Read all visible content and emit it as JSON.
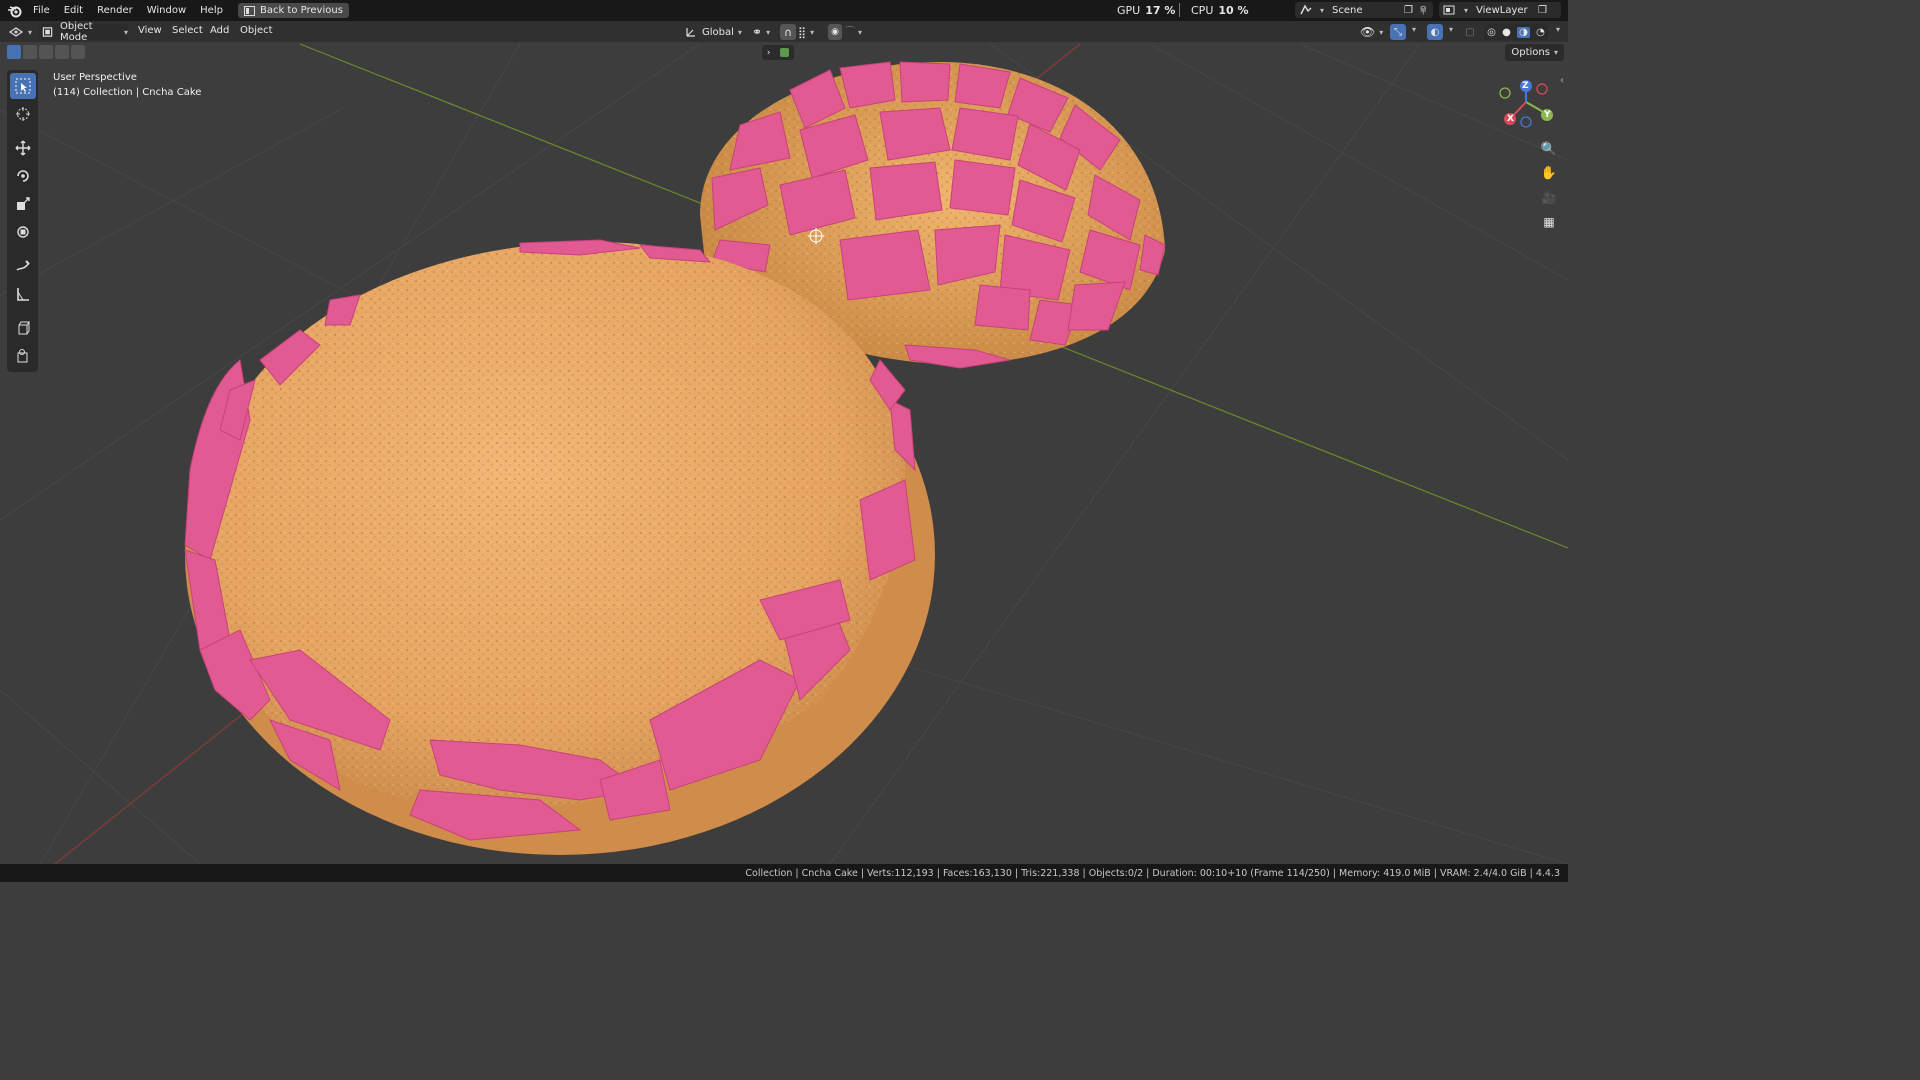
{
  "menubar": {
    "items": [
      "File",
      "Edit",
      "Render",
      "Window",
      "Help"
    ],
    "back_button": "Back to Previous"
  },
  "performance": {
    "gpu_label": "GPU",
    "gpu_value": "17 %",
    "cpu_label": "CPU",
    "cpu_value": "10 %"
  },
  "scene": {
    "name": "Scene"
  },
  "view_layer": {
    "name": "ViewLayer"
  },
  "header": {
    "mode": "Object Mode",
    "menus": [
      "View",
      "Select",
      "Add",
      "Object"
    ],
    "transform_orientation": "Global",
    "options": "Options"
  },
  "viewport": {
    "perspective": "User Perspective",
    "collection_info": "(114) Collection | Cncha Cake"
  },
  "gizmo": {
    "x": "X",
    "y": "Y",
    "z": "Z"
  },
  "statusbar": {
    "text": "Collection | Cncha Cake | Verts:112,193 | Faces:163,130 | Tris:221,338 | Objects:0/2 | Duration: 00:10+10 (Frame 114/250) | Memory: 419.0 MiB | VRAM: 2.4/4.0 GiB | 4.4.3"
  },
  "colors": {
    "accent": "#4772b3",
    "viewport_bg": "#3d3d3d",
    "bread": "#e6a866",
    "topping": "#e0588e"
  }
}
